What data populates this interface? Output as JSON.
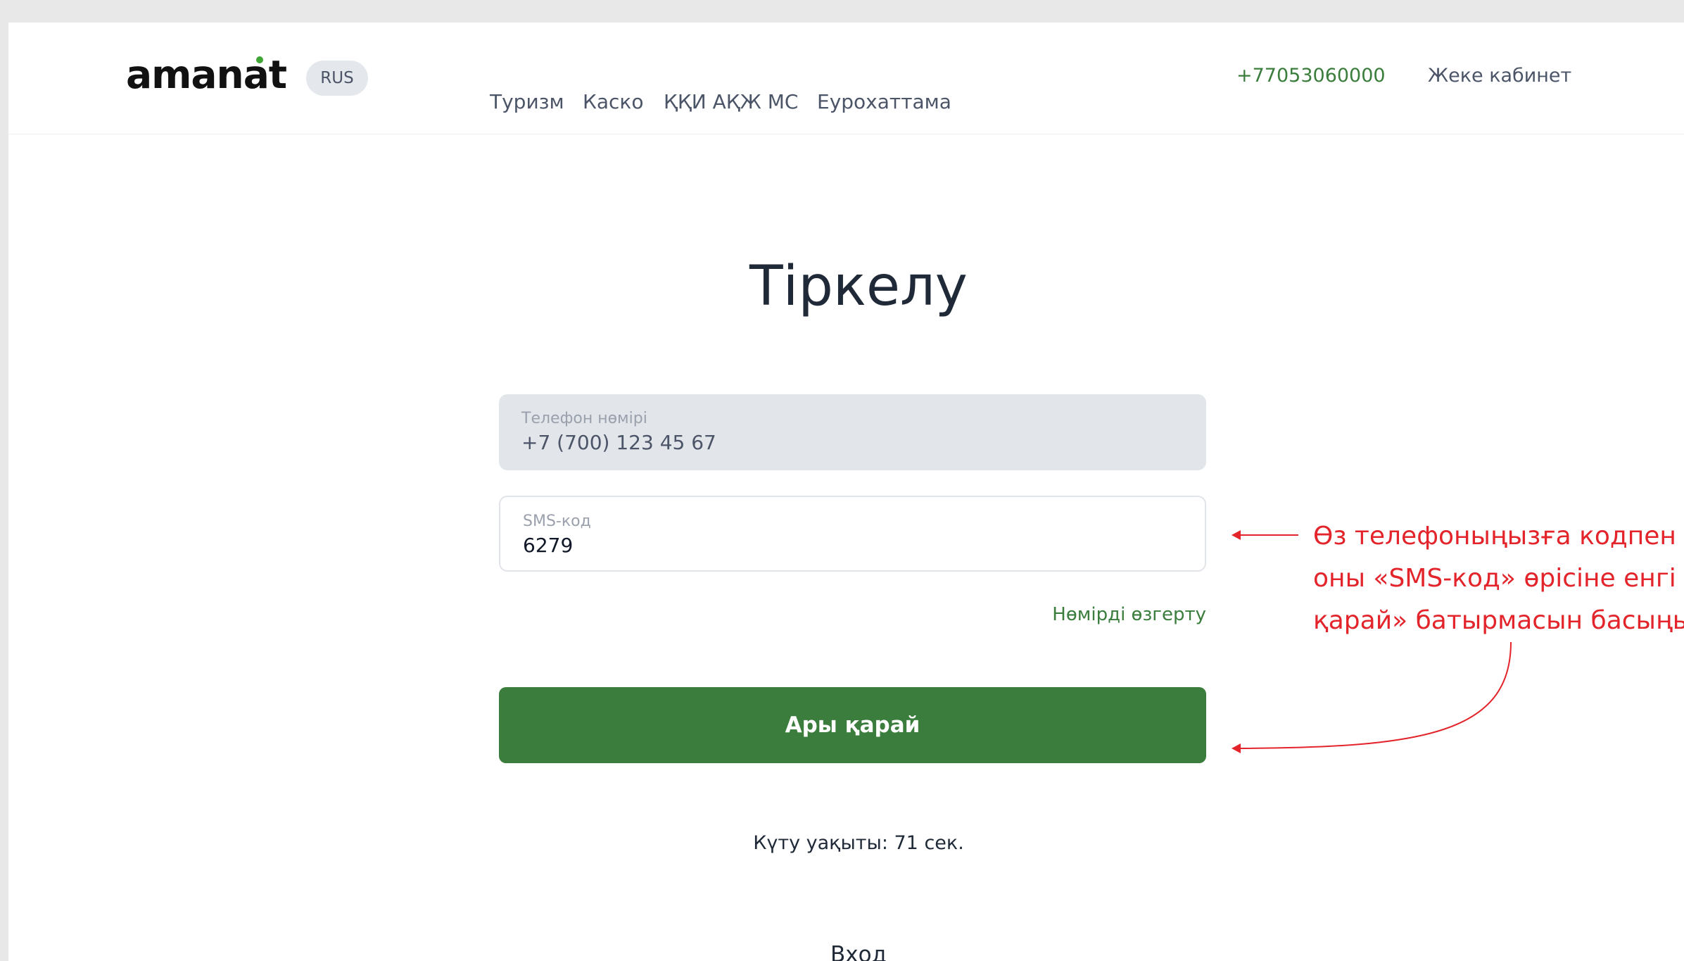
{
  "header": {
    "logo": "amanat",
    "lang": "RUS",
    "nav": [
      "Туризм",
      "Каско",
      "ҚҚИ АҚЖ МС",
      "Еурохаттама"
    ],
    "phone": "+77053060000",
    "cabinet": "Жеке кабинет"
  },
  "main": {
    "title": "Тіркелу",
    "phone_field": {
      "label": "Телефон нөмірі",
      "value": "+7 (700) 123 45 67"
    },
    "sms_field": {
      "label": "SMS-код",
      "value": "6279"
    },
    "change_number": "Нөмірді өзгерту",
    "next_button": "Ары қарай",
    "wait_text": "Күту уақыты: 71 сек.",
    "login_link": "Вход"
  },
  "annotation": {
    "lines": [
      "Өз телефоныңызға кодпен S",
      "оны «SMS-код» өрісіне енгі",
      "қарай» батырмасын басыңы"
    ]
  },
  "colors": {
    "accent": "#3a7d3c",
    "annotation": "#e3242b",
    "text": "#1f2937"
  }
}
